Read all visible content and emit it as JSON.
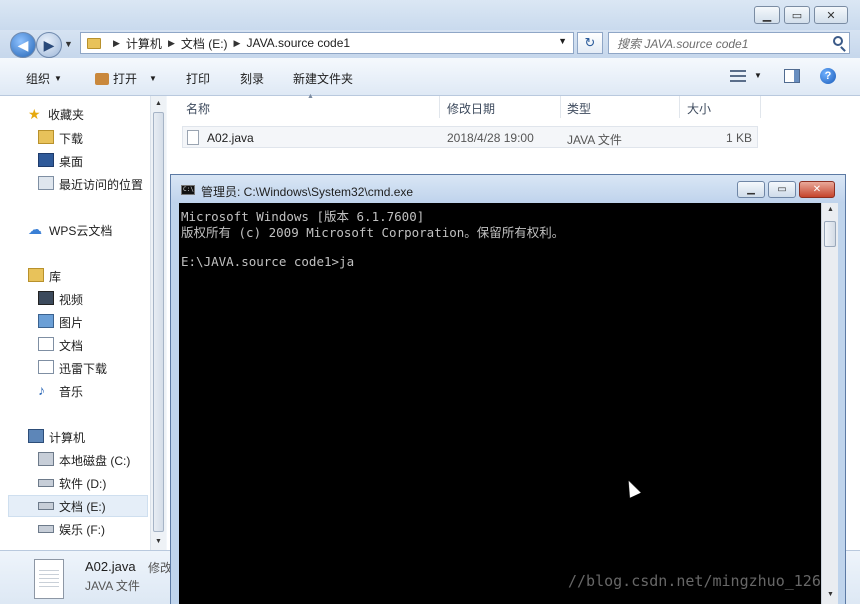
{
  "explorer": {
    "breadcrumb": [
      "计算机",
      "文档 (E:)",
      "JAVA.source code1"
    ],
    "search_placeholder": "搜索 JAVA.source code1",
    "toolbar": {
      "organize": "组织",
      "open": "打开",
      "print": "打印",
      "burn": "刻录",
      "new_folder": "新建文件夹"
    },
    "sidebar": {
      "favorites": "收藏夹",
      "downloads": "下载",
      "desktop": "桌面",
      "recent": "最近访问的位置",
      "wps": "WPS云文档",
      "libraries": "库",
      "videos": "视频",
      "pictures": "图片",
      "documents": "文档",
      "thunder": "迅雷下载",
      "music": "音乐",
      "computer": "计算机",
      "drive_c": "本地磁盘 (C:)",
      "drive_d": "软件 (D:)",
      "drive_e": "文档 (E:)",
      "drive_f": "娱乐 (F:)"
    },
    "columns": {
      "name": "名称",
      "modified": "修改日期",
      "type": "类型",
      "size": "大小"
    },
    "file": {
      "name": "A02.java",
      "modified": "2018/4/28 19:00",
      "type": "JAVA 文件",
      "size": "1 KB"
    },
    "details": {
      "name": "A02.java",
      "type": "JAVA 文件",
      "modified_label": "修改"
    }
  },
  "cmd": {
    "title": "管理员: C:\\Windows\\System32\\cmd.exe",
    "lines": [
      "Microsoft Windows [版本 6.1.7600]",
      "版权所有 (c) 2009 Microsoft Corporation。保留所有权利。",
      "",
      "E:\\JAVA.source code1>ja"
    ]
  },
  "watermark": "//blog.csdn.net/mingzhuo_126"
}
